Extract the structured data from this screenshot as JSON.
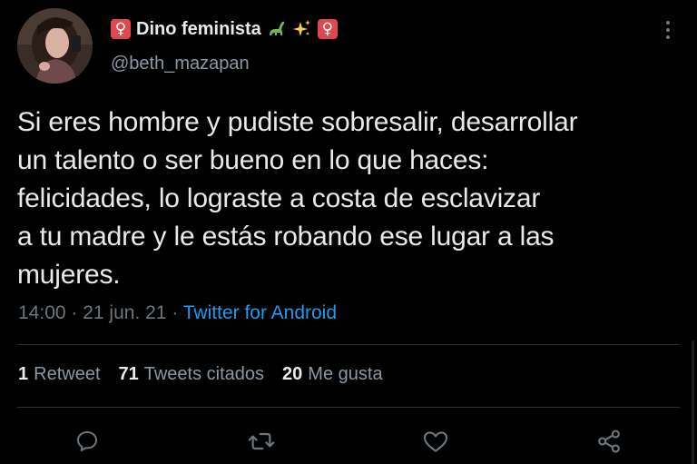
{
  "tweet": {
    "badge_glyph": "♀",
    "display_name": "Dino feminista",
    "name_emojis": [
      "sauropod-emoji",
      "sparkles-emoji",
      "female-sign-emoji"
    ],
    "handle": "@beth_mazapan",
    "text_lines": [
      "Si eres hombre y pudiste sobresalir, desarrollar",
      "un talento o ser bueno en lo que haces:",
      "felicidades, lo lograste a costa de esclavizar",
      "a tu madre y le estás robando ese lugar a las",
      "mujeres."
    ],
    "time": "14:00",
    "sep": "·",
    "date": "21 jun. 21",
    "source": "Twitter for Android"
  },
  "stats": {
    "retweets_count": "1",
    "retweets_label": "Retweet",
    "quotes_count": "71",
    "quotes_label": "Tweets citados",
    "likes_count": "20",
    "likes_label": "Me gusta"
  },
  "actions": {
    "reply_icon": "reply-icon",
    "retweet_icon": "retweet-icon",
    "like_icon": "heart-icon",
    "share_icon": "share-icon"
  },
  "colors": {
    "background": "#000000",
    "text": "#e7e9ea",
    "muted": "#6e767d",
    "link": "#1d9bf0",
    "badge": "#e0484f"
  }
}
